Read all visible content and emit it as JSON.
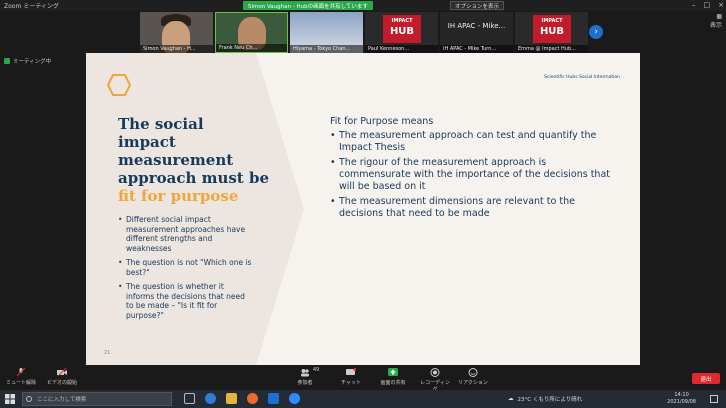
{
  "window": {
    "title": "Zoom ミーティング"
  },
  "share_bar": {
    "text": "Simon Vaughan - Hubの画面を共有しています"
  },
  "view_options": {
    "label": "オプションを表示"
  },
  "top_right": {
    "view_label": "表示"
  },
  "meeting_info": {
    "text": "ミーティング中"
  },
  "participants": [
    {
      "name": "Simon Vaughan - H..."
    },
    {
      "name": "Frank Neu Ch..."
    },
    {
      "name": "Hiyama - Tokyo Chan..."
    },
    {
      "name": "Paul Kenneson..."
    },
    {
      "name": "IH APAC - Mike Turn...",
      "big": "IH APAC - Mike..."
    },
    {
      "name": "Emma @ Impact Hub..."
    }
  ],
  "hub_logo": {
    "line1": "IMPACT",
    "line2": "HUB"
  },
  "slide": {
    "source": "Scientific Hubs Social Intermation",
    "heading_line1": "The social",
    "heading_line2": "impact",
    "heading_line3": "measurement",
    "heading_line4": "approach  must be",
    "heading_accent": "fit for purpose",
    "left_bullets": [
      "Different social impact measurement approaches have different strengths and weaknesses",
      "The question is not \"Which one is best?\"",
      "The question is whether it informs the decisions that need to be made – \"Is it fit for purpose?\""
    ],
    "page_number": "21",
    "right_heading": "Fit for Purpose means",
    "right_bullets": [
      "The measurement approach can test and quantify the Impact Thesis",
      "The rigour of the measurement approach is commensurate with the importance of the decisions that will be based on it",
      "The measurement dimensions are relevant to the decisions that need to be made"
    ]
  },
  "toolbar": {
    "mute": "ミュート解除",
    "video": "ビデオの開始",
    "participants": "参加者",
    "participant_count": "49",
    "chat": "チャット",
    "share": "画面の共有",
    "record": "レコーディング",
    "reactions": "リアクション",
    "end": "退出"
  },
  "taskbar": {
    "search_placeholder": "ここに入力して検索",
    "weather": "23°C くもり所により晴れ",
    "time": "14:10",
    "date": "2021/09/08"
  }
}
